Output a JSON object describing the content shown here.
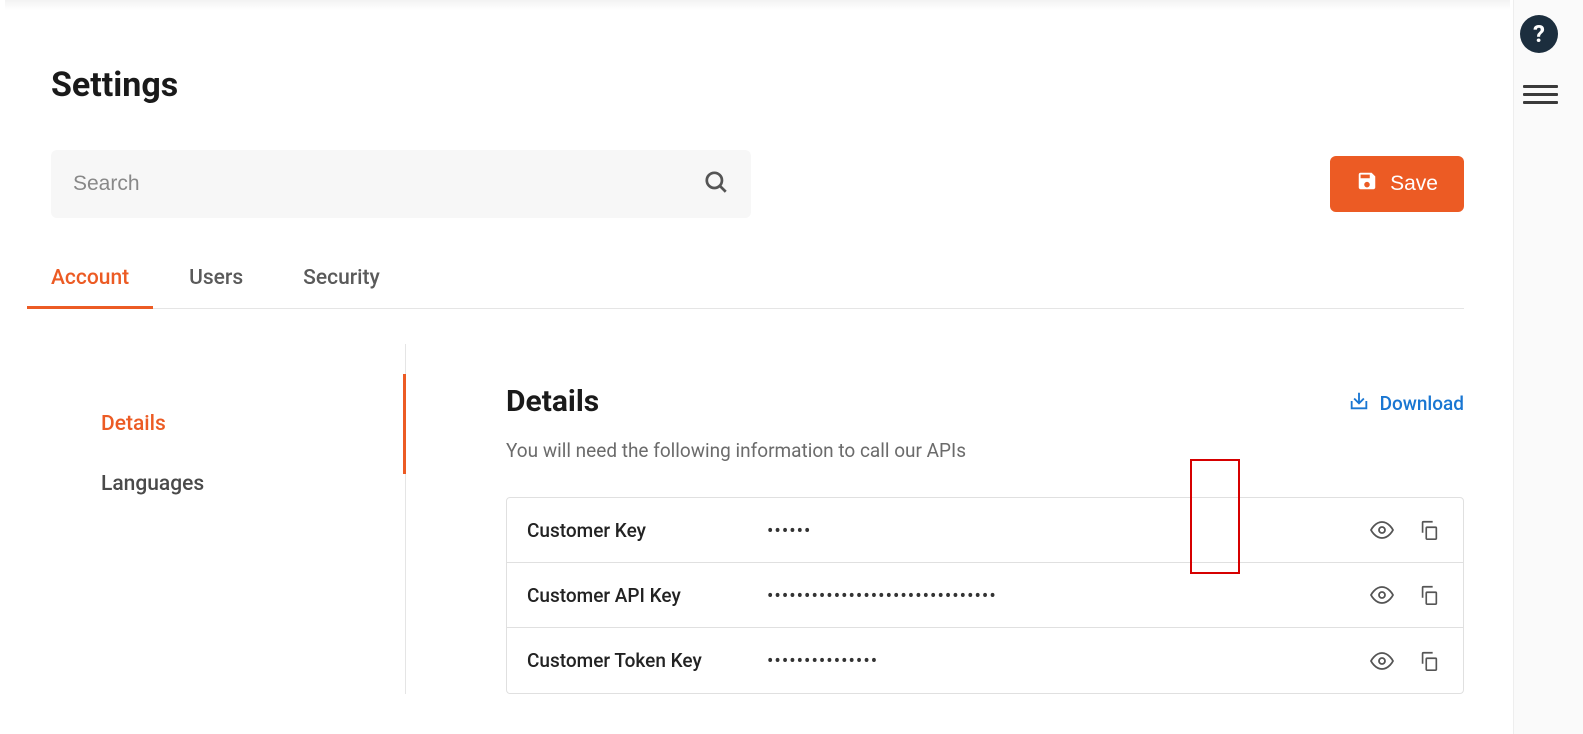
{
  "page": {
    "title": "Settings"
  },
  "search": {
    "placeholder": "Search",
    "value": ""
  },
  "buttons": {
    "save": "Save",
    "download": "Download"
  },
  "tabs": [
    {
      "label": "Account",
      "active": true
    },
    {
      "label": "Users",
      "active": false
    },
    {
      "label": "Security",
      "active": false
    }
  ],
  "sidebar": {
    "items": [
      {
        "label": "Details",
        "active": true
      },
      {
        "label": "Languages",
        "active": false
      }
    ]
  },
  "section": {
    "title": "Details",
    "description": "You will need the following information to call our APIs"
  },
  "details": [
    {
      "label": "Customer Key",
      "value": "••••••"
    },
    {
      "label": "Customer API Key",
      "value": "•••••••••••••••••••••••••••••••"
    },
    {
      "label": "Customer Token Key",
      "value": "•••••••••••••••"
    }
  ]
}
